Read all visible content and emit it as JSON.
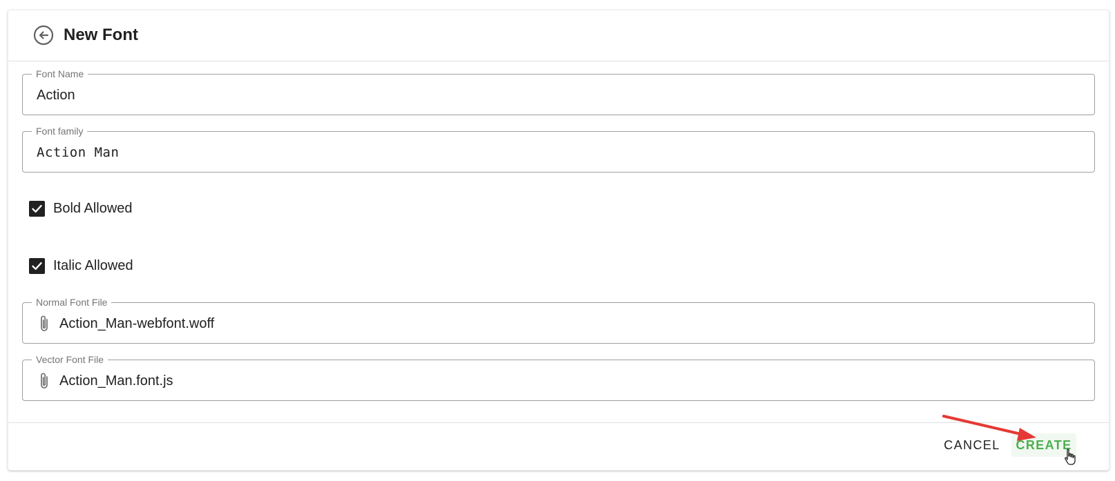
{
  "header": {
    "title": "New Font"
  },
  "fields": {
    "font_name": {
      "label": "Font Name",
      "value": "Action"
    },
    "font_family": {
      "label": "Font family",
      "value": "Action Man"
    },
    "normal_font_file": {
      "label": "Normal Font File",
      "value": "Action_Man-webfont.woff"
    },
    "vector_font_file": {
      "label": "Vector Font File",
      "value": "Action_Man.font.js"
    }
  },
  "checkboxes": {
    "bold": {
      "label": "Bold Allowed",
      "checked": true
    },
    "italic": {
      "label": "Italic Allowed",
      "checked": true
    }
  },
  "footer": {
    "cancel_label": "CANCEL",
    "create_label": "CREATE"
  },
  "icons": {
    "back": "arrow-circle-left-icon",
    "attachment": "paperclip-icon",
    "check": "checkmark-icon",
    "cursor": "hand-pointer-icon"
  },
  "colors": {
    "accent_green": "#4caf50",
    "annotation_red": "#e53935",
    "text": "#212121",
    "label": "#757575",
    "border": "#9e9e9e"
  }
}
